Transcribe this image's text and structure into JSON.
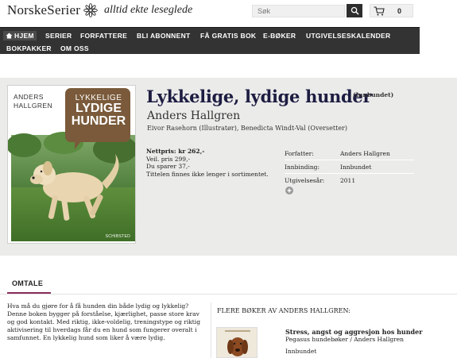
{
  "header": {
    "logo_text": "NorskeSerier",
    "tagline": "alltid ekte leseglede",
    "search_placeholder": "Søk",
    "cart_count": "0"
  },
  "nav": {
    "items": [
      "HJEM",
      "SERIER",
      "FORFATTERE",
      "BLI ABONNENT",
      "FÅ GRATIS BOK",
      "E-BØKER",
      "UTGIVELSESKALENDER",
      "BOKPAKKER",
      "OM OSS"
    ]
  },
  "cover": {
    "author": "ANDERS HALLGREN",
    "title_line1": "LYKKELIGE",
    "title_line2": "LYDIGE",
    "title_line3": "HUNDER",
    "publisher": "SCHIBSTED"
  },
  "product": {
    "title": "Lykkelige, lydige hunder",
    "binding_tag": "(Innbundet)",
    "author": "Anders Hallgren",
    "contributors": "Eivor Rasehorn (Illustratør), Benedicta Windt-Val (Oversetter)",
    "net_price": "Nettpris: kr 262,-",
    "list_price": "Veil. pris 299,-",
    "savings": "Du sparer 37,-",
    "availability": "Tittelen finnes ikke lenger i sortimentet."
  },
  "info": [
    {
      "key": "Forfatter:",
      "value": "Anders Hallgren"
    },
    {
      "key": "Innbinding:",
      "value": "Innbundet"
    },
    {
      "key": "Utgivelsesår:",
      "value": "2011"
    }
  ],
  "omtale": {
    "tab_label": "OMTALE",
    "text": "Hva må du gjøre for å få hunden din både lydig og lykkelig? Denne boken bygger på forståelse, kjærlighet, passe store krav og god kontakt. Med riktig, ikke-voldelig, treningstype og riktig aktivisering til hverdags får du en hund som fungerer overalt i samfunnet. En lykkelig hund som liker å være lydig."
  },
  "more_books": {
    "heading": "FLERE BØKER AV ANDERS HALLGREN:",
    "items": [
      {
        "title": "Stress, angst og aggresjon hos hunder",
        "series": "Pegasus hundebøker / Anders Hallgren",
        "binding": "Innbundet"
      }
    ]
  },
  "colors": {
    "nav_bg": "#333333",
    "title_color": "#1d1d42",
    "tab_accent": "#8a2d5e",
    "band_bg": "#ebebea",
    "cover_badge": "#7a5a3a"
  }
}
